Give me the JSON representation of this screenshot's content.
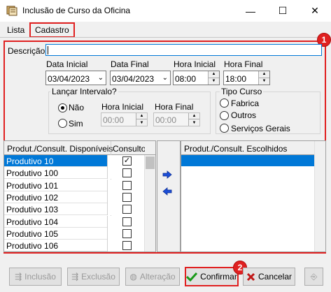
{
  "window": {
    "title": "Inclusão de Curso da Oficina",
    "minimize": "—",
    "maximize": "☐",
    "close": "✕"
  },
  "tabs": [
    {
      "label": "Lista"
    },
    {
      "label": "Cadastro"
    }
  ],
  "badges": {
    "one": "1",
    "two": "2"
  },
  "form": {
    "descricao_label": "Descrição:",
    "descricao_value": "",
    "data_inicial_label": "Data Inicial",
    "data_inicial_value": "03/04/2023",
    "data_final_label": "Data Final",
    "data_final_value": "03/04/2023",
    "hora_inicial_label": "Hora Inicial",
    "hora_inicial_value": "08:00",
    "hora_final_label": "Hora Final",
    "hora_final_value": "18:00"
  },
  "intervalo": {
    "title": "Lançar Intervalo?",
    "nao_label": "Não",
    "sim_label": "Sim",
    "selected": "Não",
    "hora_inicial_label": "Hora Inicial",
    "hora_inicial_value": "00:00",
    "hora_final_label": "Hora Final",
    "hora_final_value": "00:00"
  },
  "tipo_curso": {
    "title": "Tipo Curso",
    "options": [
      "Fabrica",
      "Outros",
      "Serviços Gerais"
    ]
  },
  "disponiveis": {
    "col1": "Produt./Consult. Disponíveis",
    "col2": "Consultor",
    "rows": [
      {
        "name": "Produtivo 10",
        "checked": true
      },
      {
        "name": "Produtivo 100",
        "checked": false
      },
      {
        "name": "Produtivo 101",
        "checked": false
      },
      {
        "name": "Produtivo 102",
        "checked": false
      },
      {
        "name": "Produtivo 103",
        "checked": false
      },
      {
        "name": "Produtivo 104",
        "checked": false
      },
      {
        "name": "Produtivo 105",
        "checked": false
      },
      {
        "name": "Produtivo 106",
        "checked": false
      }
    ]
  },
  "escolhidos": {
    "col1": "Produt./Consult. Escolhidos"
  },
  "buttons": {
    "inclusao": "Inclusão",
    "exclusao": "Exclusão",
    "alteracao": "Alteração",
    "confirmar": "Confirmar",
    "cancelar": "Cancelar"
  },
  "colors": {
    "accent": "#0078d7",
    "highlight": "#e02020"
  }
}
